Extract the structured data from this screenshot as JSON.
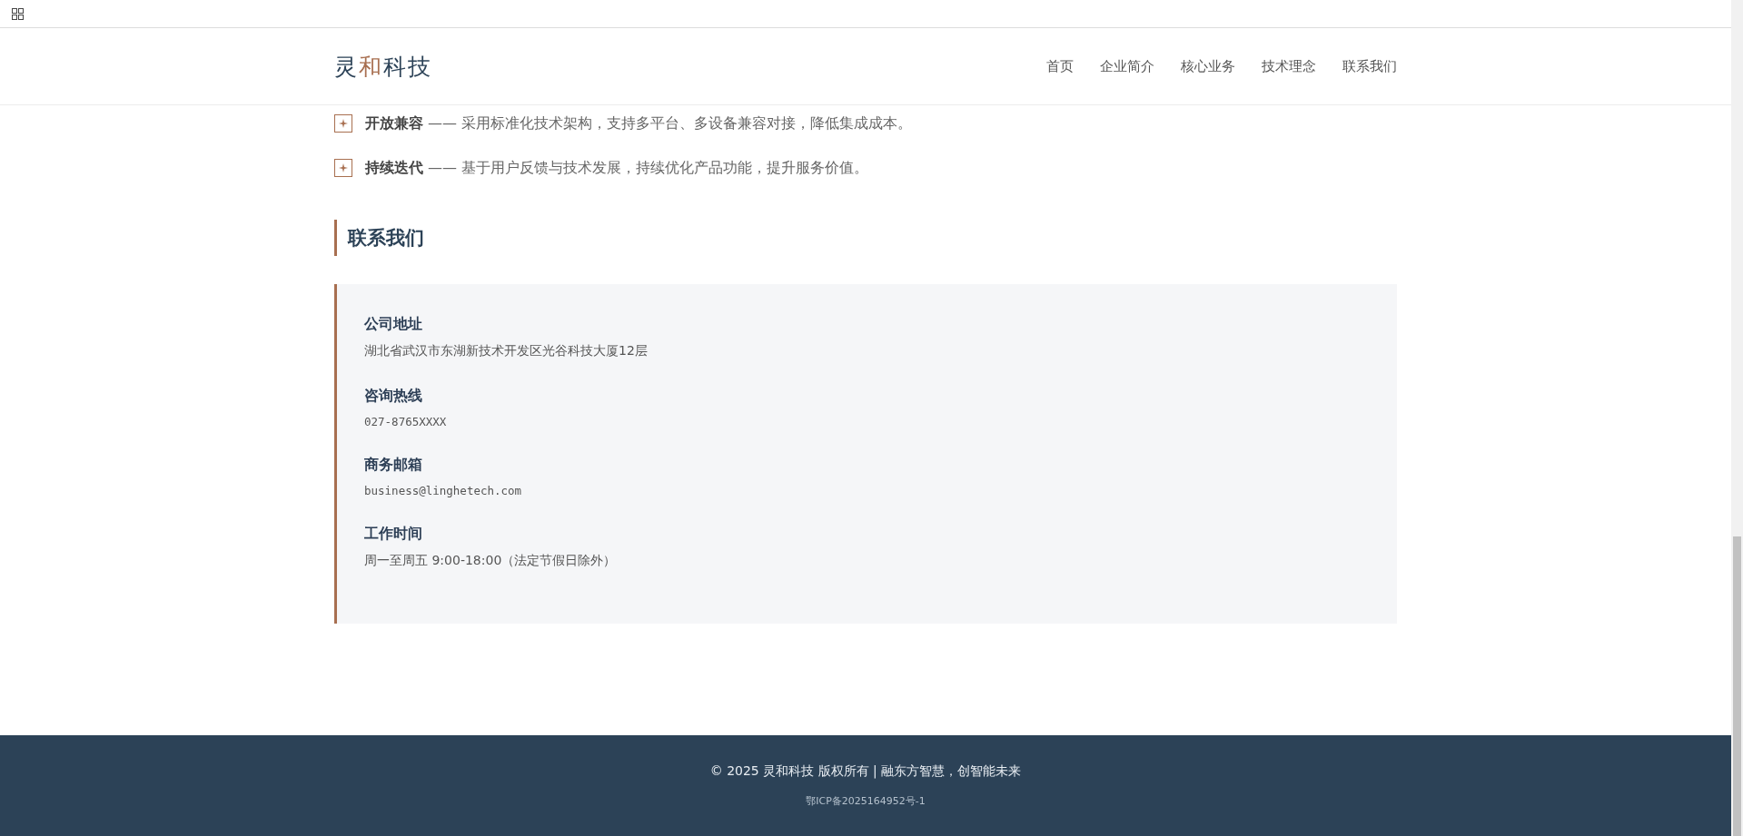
{
  "header": {
    "logo": [
      {
        "text": "灵",
        "accent": false
      },
      {
        "text": "和",
        "accent": true
      },
      {
        "text": "科技",
        "accent": false
      }
    ],
    "nav": [
      {
        "label": "首页",
        "selected": false
      },
      {
        "label": "企业简介",
        "selected": false
      },
      {
        "label": "核心业务",
        "selected": false
      },
      {
        "label": "技术理念",
        "selected": false
      },
      {
        "label": "联系我们",
        "selected": false
      }
    ]
  },
  "principles": [
    {
      "text": "**开放兼容** —— 采用标准化技术架构，支持多平台、多设备兼容对接，降低集成成本。"
    },
    {
      "text": "**持续迭代** —— 基于用户反馈与技术发展，持续优化产品功能，提升服务价值。"
    }
  ],
  "contact": {
    "title": "联系我们",
    "items": [
      {
        "label": "公司地址",
        "value": "湖北省武汉市东湖新技术开发区光谷科技大厦12层",
        "kind": "text"
      },
      {
        "label": "咨询热线",
        "value": "027-8765XXXX",
        "kind": "mono"
      },
      {
        "label": "商务邮箱",
        "value": "business@linghetech.com",
        "kind": "mono"
      },
      {
        "label": "工作时间",
        "value": "周一至周五 9:00-18:00（法定节假日除外）",
        "kind": "text"
      }
    ]
  },
  "footer": {
    "copyright": "© 2025 灵和科技 版权所有 | 融东方智慧，创智能未来",
    "icp": "鄂ICP备2025164952号-1"
  }
}
